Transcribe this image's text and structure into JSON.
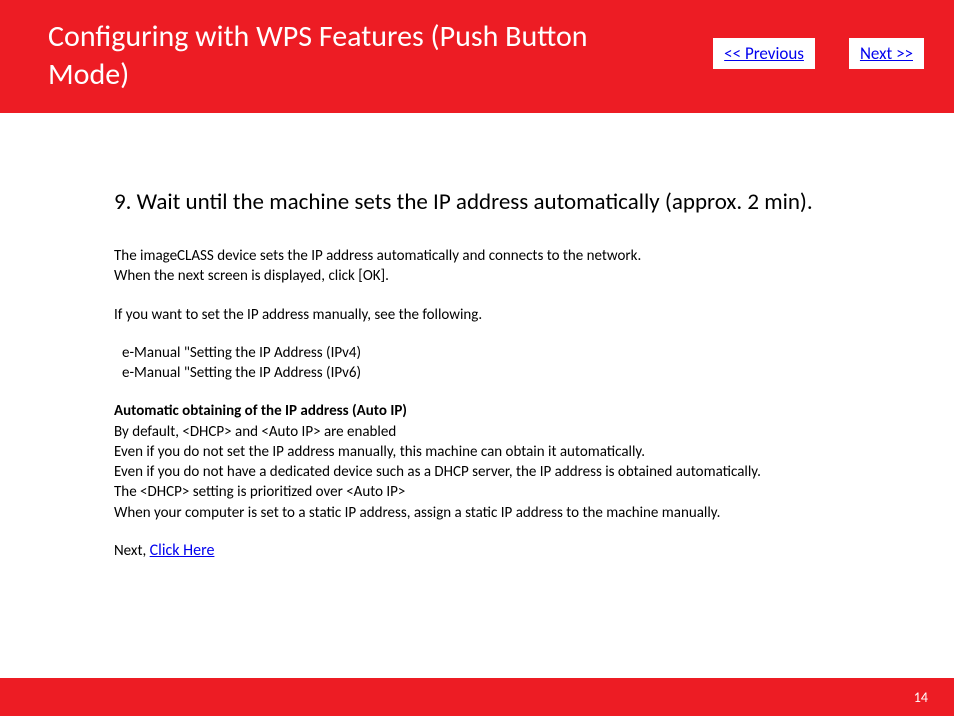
{
  "header": {
    "title": "Configuring with WPS Features (Push Button Mode)",
    "prev_label": "<< Previous",
    "next_label": "Next >>"
  },
  "content": {
    "step_heading": "9. Wait until the machine sets the IP address automatically (approx. 2 min).",
    "p1_line1": "The imageCLASS device sets the IP address automatically and connects to the network.",
    "p1_line2": "When the next screen is displayed, click [OK].",
    "p2": "If you want to set the IP address manually, see the following.",
    "ref1": "e-Manual \"Setting the IP Address (IPv4)",
    "ref2": "e-Manual \"Setting the IP Address (IPv6)",
    "auto_heading": "Automatic obtaining of the IP address (Auto IP)",
    "auto_l1": "By default, <DHCP> and <Auto IP> are enabled",
    "auto_l2": "Even if you do not set the IP address manually, this machine can obtain it automatically.",
    "auto_l3": " Even if you do not have a dedicated device such as a DHCP server, the IP address is obtained automatically.",
    "auto_l4": " The <DHCP> setting is prioritized over <Auto IP>",
    "auto_l5": "When your computer is set to a static IP address, assign a static IP address to the machine manually.",
    "next_prefix": "Next, ",
    "next_link": "Click Here"
  },
  "footer": {
    "page_number": "14"
  }
}
